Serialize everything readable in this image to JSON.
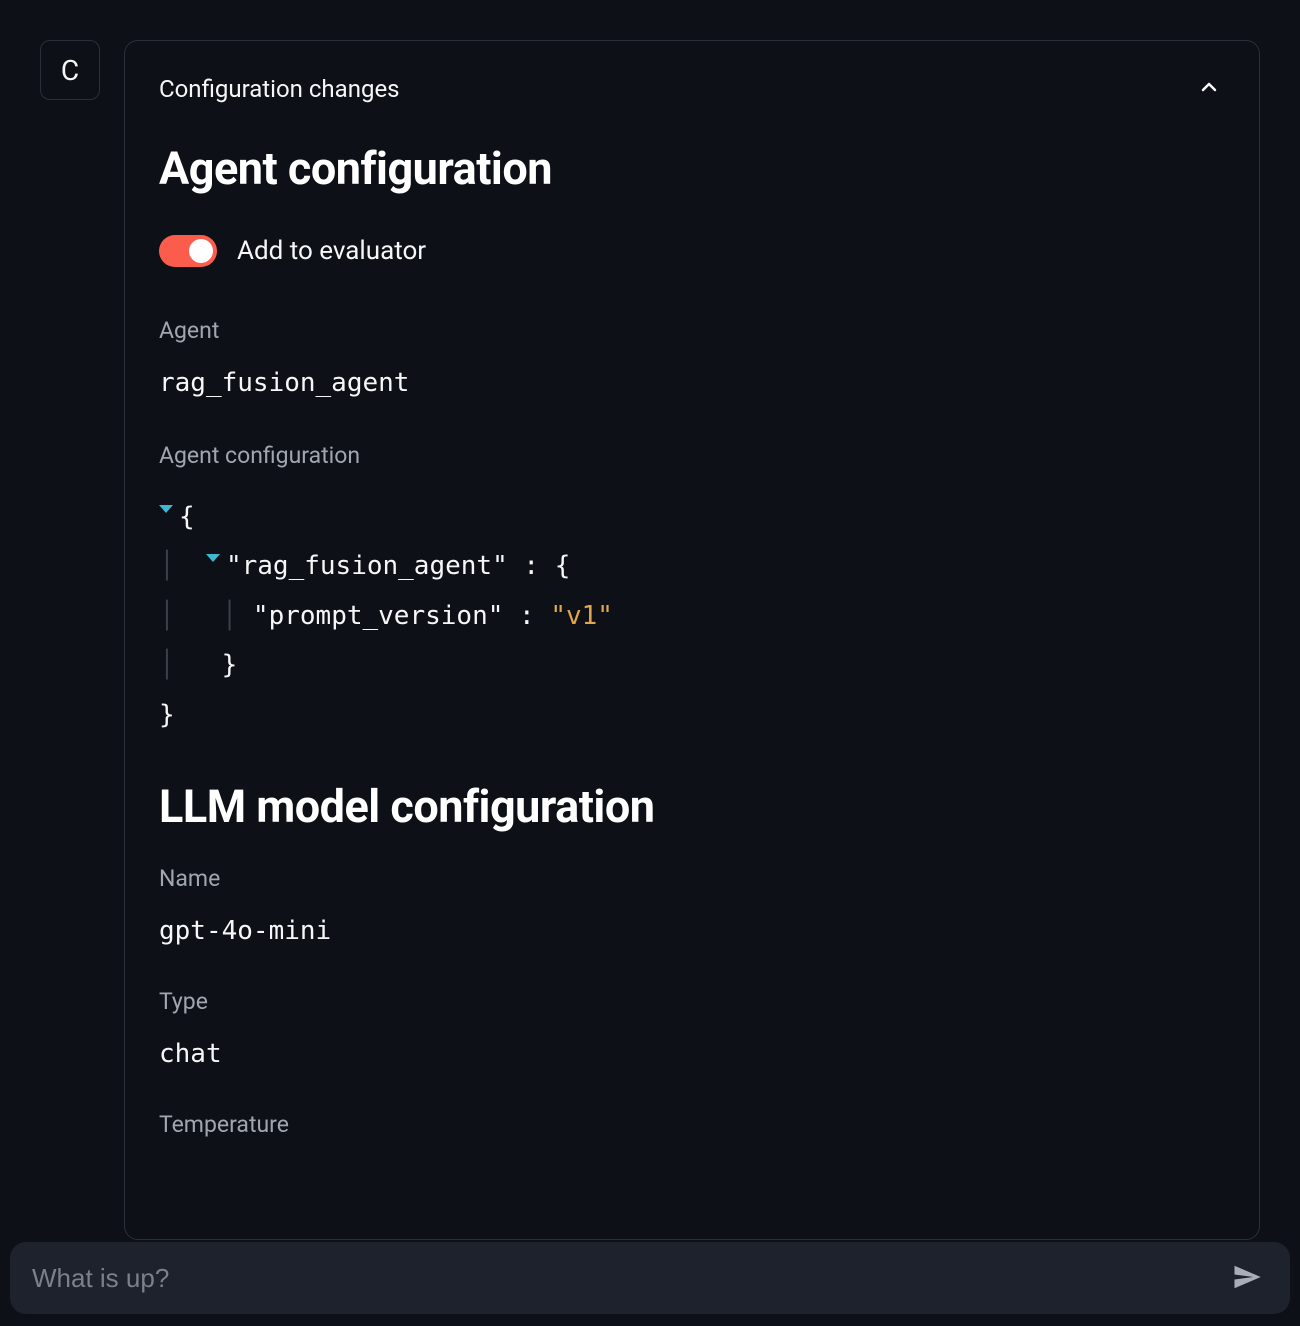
{
  "avatar": {
    "letter": "C"
  },
  "panel": {
    "header_title": "Configuration changes"
  },
  "agent_section": {
    "title": "Agent configuration",
    "toggle_label": "Add to evaluator",
    "toggle_on": true,
    "agent_label": "Agent",
    "agent_value": "rag_fusion_agent",
    "config_label": "Agent configuration",
    "json": {
      "rag_fusion_agent": {
        "prompt_version": "v1"
      }
    },
    "json_tokens": {
      "open_outer": "{",
      "key1": "\"rag_fusion_agent\"",
      "colon": " : ",
      "open_inner": "{",
      "key2": "\"prompt_version\"",
      "val2": "\"v1\"",
      "close_inner": "}",
      "close_outer": "}"
    }
  },
  "llm_section": {
    "title": "LLM model configuration",
    "name_label": "Name",
    "name_value": "gpt-4o-mini",
    "type_label": "Type",
    "type_value": "chat",
    "temperature_label": "Temperature"
  },
  "chat": {
    "placeholder": "What is up?"
  }
}
